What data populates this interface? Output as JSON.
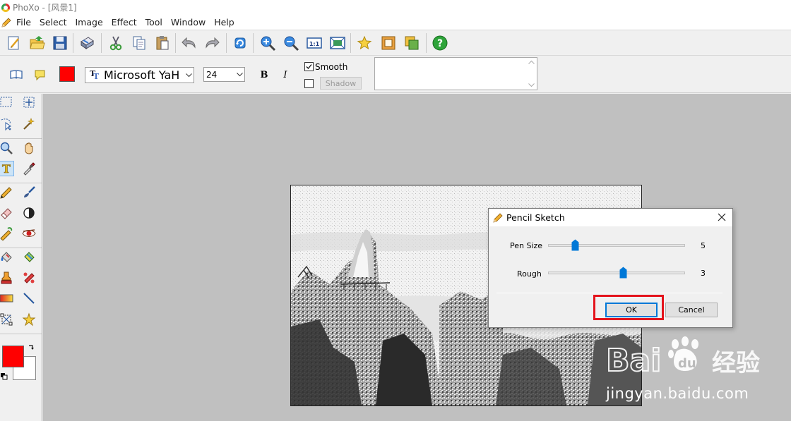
{
  "window": {
    "title": "PhoXo - [风景1]"
  },
  "menu": {
    "items": [
      "File",
      "Select",
      "Image",
      "Effect",
      "Tool",
      "Window",
      "Help"
    ]
  },
  "text_options": {
    "color": "#ff0000",
    "font_name": "Microsoft YaH",
    "font_size": "24",
    "bold_label": "B",
    "italic_label": "I",
    "smooth_label": "Smooth",
    "smooth_checked": true,
    "shadow_checked": false,
    "shadow_label": "Shadow",
    "text_value": ""
  },
  "colors": {
    "foreground": "#ff0000",
    "background": "#ffffff",
    "workspace": "#c0c0c0",
    "highlight": "#e4141c"
  },
  "dialog": {
    "title": "Pencil Sketch",
    "pen_size_label": "Pen Size",
    "pen_size_value": "5",
    "pen_size_fraction": 0.2,
    "rough_label": "Rough",
    "rough_value": "3",
    "rough_fraction": 0.55,
    "ok_label": "OK",
    "cancel_label": "Cancel"
  },
  "watermark": {
    "brand": "Bai du 经验",
    "url": "jingyan.baidu.com"
  }
}
